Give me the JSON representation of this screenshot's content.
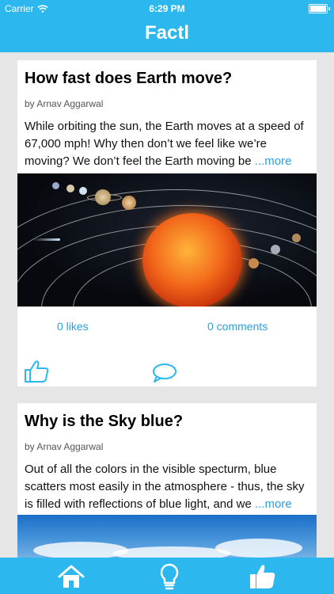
{
  "status": {
    "carrier": "Carrier",
    "time": "6:29 PM"
  },
  "nav": {
    "title": "Factl"
  },
  "posts": [
    {
      "title": "How fast does Earth move?",
      "author": "by Arnav Aggarwal",
      "body": "While orbiting the sun, the Earth moves at a speed of 67,000 mph! Why then don’t we feel like we’re moving? We don’t feel the Earth moving be ",
      "more": "...more",
      "likes": "0 likes",
      "comments": "0 comments",
      "image": "solar-system-image"
    },
    {
      "title": "Why is the Sky blue?",
      "author": "by Arnav Aggarwal",
      "body": "Out of all the colors in the visible specturm, blue scatters most easily in the atmosphere - thus, the sky is filled with reflections of blue light, and we ",
      "more": "...more",
      "image": "blue-sky-image"
    }
  ],
  "tabbar": {
    "items": [
      "home-icon",
      "lightbulb-icon",
      "thumbs-up-icon"
    ]
  },
  "colors": {
    "brand": "#2cb8ee",
    "link": "#2a9fe0"
  }
}
